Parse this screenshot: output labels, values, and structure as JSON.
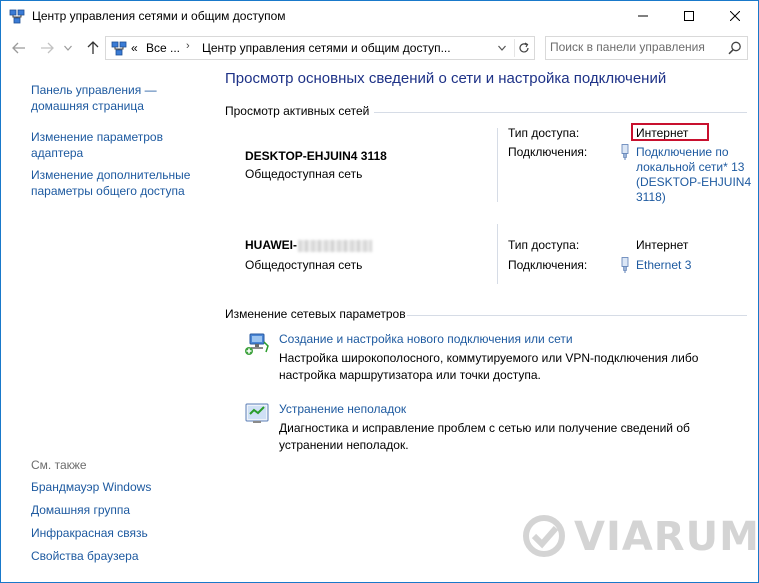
{
  "window": {
    "title": "Центр управления сетями и общим доступом"
  },
  "address": {
    "overflow": "«",
    "crumb1": "Все ...",
    "crumb2": "Центр управления сетями и общим доступ...",
    "search_placeholder": "Поиск в панели управления"
  },
  "sidebar": {
    "items": [
      {
        "label": "Панель управления — домашняя страница"
      },
      {
        "label": "Изменение параметров адаптера"
      },
      {
        "label": "Изменение дополнительные параметры общего доступа"
      }
    ],
    "see_also_label": "См. также",
    "see_also": [
      {
        "label": "Брандмауэр Windows"
      },
      {
        "label": "Домашняя группа"
      },
      {
        "label": "Инфракрасная связь"
      },
      {
        "label": "Свойства браузера"
      }
    ]
  },
  "main": {
    "title": "Просмотр основных сведений о сети и настройка подключений",
    "active_networks_header": "Просмотр активных сетей",
    "access_label": "Тип доступа:",
    "connections_label": "Подключения:",
    "networks": [
      {
        "name": "DESKTOP-EHJUIN4 3118",
        "category": "Общедоступная сеть",
        "access_type": "Интернет",
        "connection": "Подключение по локальной сети* 13 (DESKTOP-EHJUIN4 3118)",
        "connection_lines": [
          "Подключение по",
          "локальной сети* 13",
          "(DESKTOP-EHJUIN4",
          "3118)"
        ]
      },
      {
        "name": "HUAWEI-",
        "category": "Общедоступная сеть",
        "access_type": "Интернет",
        "connection": "Ethernet 3"
      }
    ],
    "change_settings_header": "Изменение сетевых параметров",
    "tasks": [
      {
        "label": "Создание и настройка нового подключения или сети",
        "description": "Настройка широкополосного, коммутируемого или VPN-подключения либо настройка маршрутизатора или точки доступа."
      },
      {
        "label": "Устранение неполадок",
        "description": "Диагностика и исправление проблем с сетью или получение сведений об устранении неполадок."
      }
    ]
  },
  "watermark": {
    "text": "VIARUM"
  },
  "colors": {
    "link": "#1e5aa0",
    "title": "#1e3287",
    "highlight": "#c8102e"
  }
}
